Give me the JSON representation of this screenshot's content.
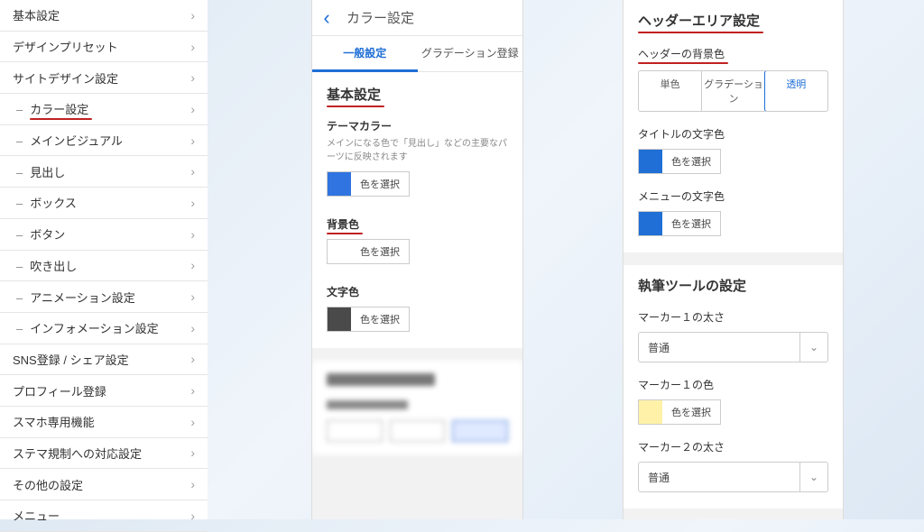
{
  "sidebar": {
    "items": [
      {
        "label": "基本設定",
        "sub": false
      },
      {
        "label": "デザインプリセット",
        "sub": false
      },
      {
        "label": "サイトデザイン設定",
        "sub": false
      },
      {
        "label": "カラー設定",
        "sub": true,
        "highlight": true
      },
      {
        "label": "メインビジュアル",
        "sub": true
      },
      {
        "label": "見出し",
        "sub": true
      },
      {
        "label": "ボックス",
        "sub": true
      },
      {
        "label": "ボタン",
        "sub": true
      },
      {
        "label": "吹き出し",
        "sub": true
      },
      {
        "label": "アニメーション設定",
        "sub": true
      },
      {
        "label": "インフォメーション設定",
        "sub": true
      },
      {
        "label": "SNS登録 / シェア設定",
        "sub": false
      },
      {
        "label": "プロフィール登録",
        "sub": false
      },
      {
        "label": "スマホ専用機能",
        "sub": false
      },
      {
        "label": "ステマ規制への対応設定",
        "sub": false
      },
      {
        "label": "その他の設定",
        "sub": false
      },
      {
        "label": "メニュー",
        "sub": false
      }
    ]
  },
  "mid": {
    "title": "カラー設定",
    "tabs": {
      "general": "一般設定",
      "gradient": "グラデーション登録"
    },
    "section_basic_title": "基本設定",
    "theme_color": {
      "label": "テーマカラー",
      "desc": "メインになる色で「見出し」などの主要なパーツに反映されます",
      "pick": "色を選択",
      "swatch": "#2f74e0"
    },
    "bg_color": {
      "label": "背景色",
      "pick": "色を選択",
      "swatch": "#ffffff"
    },
    "text_color": {
      "label": "文字色",
      "pick": "色を選択",
      "swatch": "#4a4a4a"
    }
  },
  "right": {
    "header_area_title": "ヘッダーエリア設定",
    "header_bg_label": "ヘッダーの背景色",
    "seg": {
      "solid": "単色",
      "gradient": "グラデーション",
      "transparent": "透明"
    },
    "title_color": {
      "label": "タイトルの文字色",
      "pick": "色を選択",
      "swatch": "#1f6fd6"
    },
    "menu_color": {
      "label": "メニューの文字色",
      "pick": "色を選択",
      "swatch": "#1f6fd6"
    },
    "writing_tools_title": "執筆ツールの設定",
    "marker1_thickness": {
      "label": "マーカー１の太さ",
      "value": "普通"
    },
    "marker1_color": {
      "label": "マーカー１の色",
      "pick": "色を選択",
      "swatch": "#fff2a8"
    },
    "marker2_thickness": {
      "label": "マーカー２の太さ",
      "value": "普通"
    }
  }
}
